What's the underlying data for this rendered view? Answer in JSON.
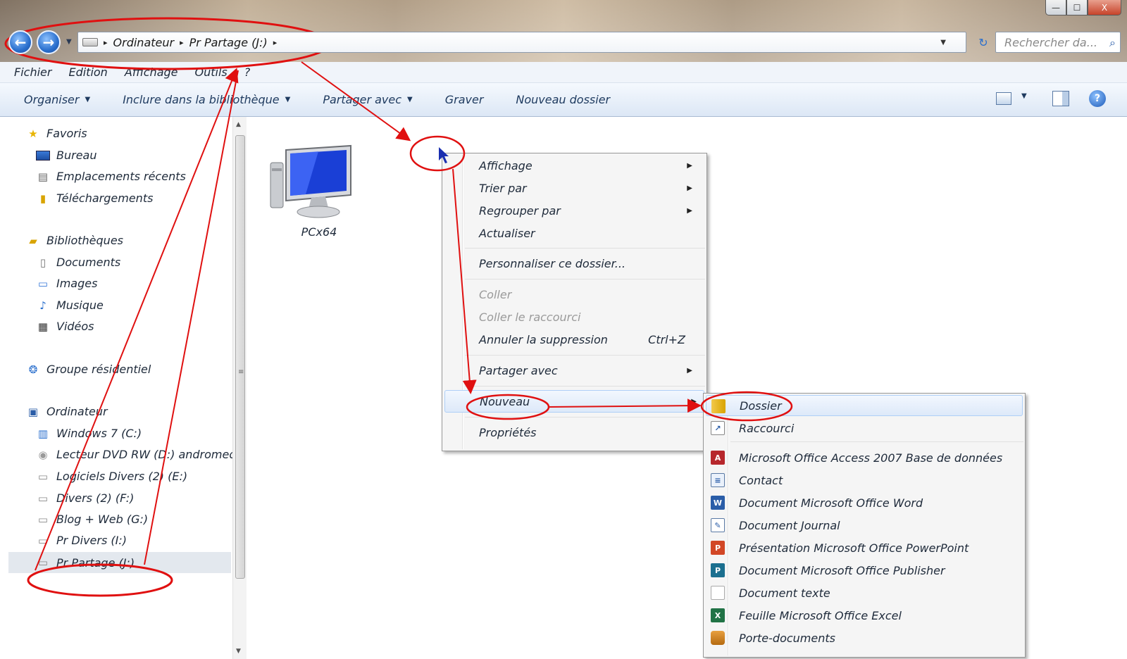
{
  "window": {
    "minimize": "—",
    "maximize": "☐",
    "close": "X"
  },
  "nav": {
    "back": "←",
    "forward": "→",
    "dropdown": "▼"
  },
  "address": {
    "crumbs": [
      "Ordinateur",
      "Pr  Partage (J:)"
    ],
    "separator": "▸",
    "dropdown": "▼",
    "refresh": "↻"
  },
  "search": {
    "placeholder": "Rechercher da...",
    "icon": "⌕"
  },
  "menubar": {
    "items": [
      "Fichier",
      "Edition",
      "Affichage",
      "Outils",
      "?"
    ]
  },
  "toolbar": {
    "organiser": "Organiser",
    "inclure": "Inclure dans la bibliothèque",
    "partager": "Partager avec",
    "graver": "Graver",
    "nouveau_dossier": "Nouveau dossier",
    "caret": "▼",
    "help": "?"
  },
  "sidebar": {
    "favoris": "Favoris",
    "bureau": "Bureau",
    "recents": "Emplacements récents",
    "telechargements": "Téléchargements",
    "bibliotheques": "Bibliothèques",
    "documents": "Documents",
    "images": "Images",
    "musique": "Musique",
    "videos": "Vidéos",
    "groupe": "Groupe résidentiel",
    "ordinateur": "Ordinateur",
    "drive_c": "Windows 7 (C:)",
    "drive_d": "Lecteur DVD RW (D:) andromed",
    "drive_e": "Logiciels Divers (2) (E:)",
    "drive_f": "Divers (2) (F:)",
    "drive_g": "Blog + Web (G:)",
    "drive_i": "Pr  Divers (I:)",
    "drive_j": "Pr  Partage (J:)",
    "scroll_up": "▲",
    "scroll_down": "▼",
    "grip": "≡"
  },
  "content": {
    "pc_label": "PCx64"
  },
  "context_menu": {
    "affichage": "Affichage",
    "trier": "Trier par",
    "regrouper": "Regrouper par",
    "actualiser": "Actualiser",
    "personnaliser": "Personnaliser ce dossier...",
    "coller": "Coller",
    "coller_raccourci": "Coller le raccourci",
    "annuler": "Annuler la suppression",
    "annuler_shortcut": "Ctrl+Z",
    "partager": "Partager avec",
    "nouveau": "Nouveau",
    "proprietes": "Propriétés",
    "arrow": "▶"
  },
  "submenu": {
    "dossier": "Dossier",
    "raccourci": "Raccourci",
    "access": "Microsoft Office Access 2007 Base de données",
    "contact": "Contact",
    "word": "Document Microsoft Office Word",
    "journal": "Document Journal",
    "powerpoint": "Présentation Microsoft Office PowerPoint",
    "publisher": "Document Microsoft Office Publisher",
    "texte": "Document texte",
    "excel": "Feuille Microsoft Office Excel",
    "porte_documents": "Porte-documents"
  },
  "colors": {
    "annotation": "#e01010",
    "cursor": "#1a2fb0"
  }
}
